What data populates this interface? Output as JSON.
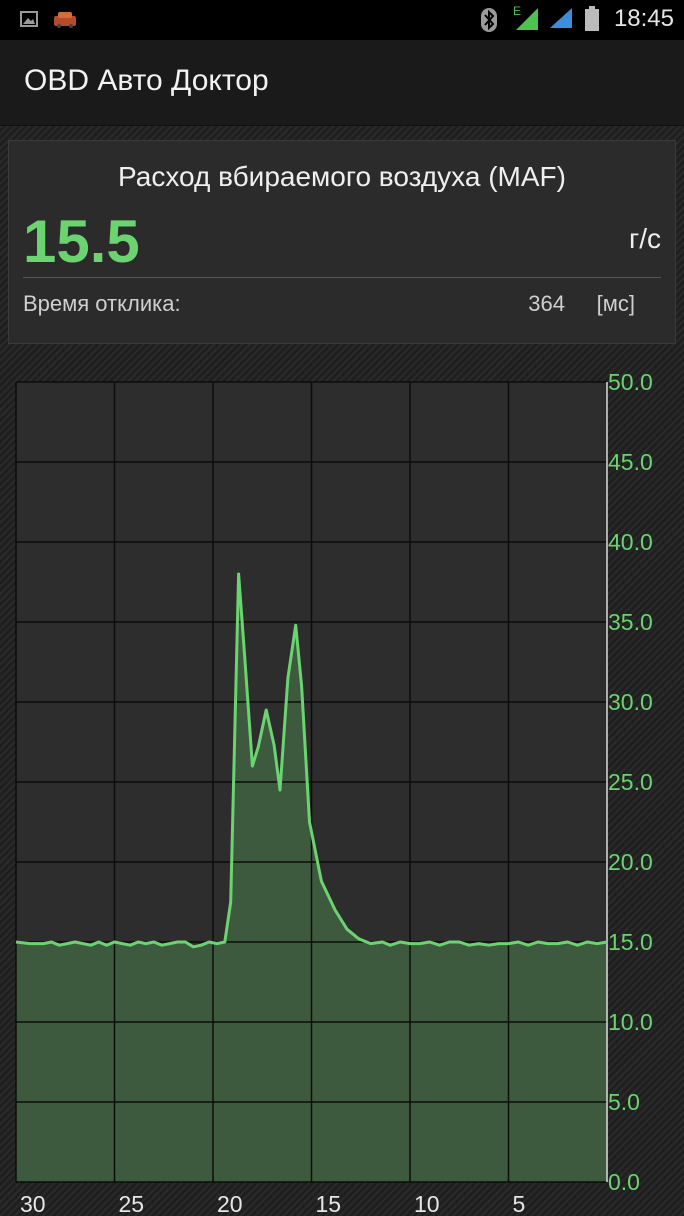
{
  "status_bar": {
    "time": "18:45",
    "icons": [
      "image-notification-icon",
      "car-notification-icon",
      "bluetooth-icon",
      "signal-e-icon",
      "signal-icon",
      "battery-icon"
    ],
    "network_label": "E"
  },
  "app": {
    "title": "OBD Авто Доктор"
  },
  "sensor": {
    "name": "Расход вбираемого воздуха (MAF)",
    "value": "15.5",
    "unit": "г/с",
    "response_label": "Время отклика:",
    "response_value": "364",
    "response_unit": "[мс]"
  },
  "colors": {
    "accent": "#6bd36f",
    "fill": "#3e5a3e",
    "grid": "#0c0c0c",
    "plot_bg": "#2d2d2d"
  },
  "chart_data": {
    "type": "area",
    "title": "",
    "xlabel": "",
    "ylabel": "",
    "ylim": [
      0,
      50
    ],
    "xlim": [
      30,
      0
    ],
    "x_ticks": [
      "30",
      "25",
      "20",
      "15",
      "10",
      "5"
    ],
    "y_ticks": [
      "50.0",
      "45.0",
      "40.0",
      "35.0",
      "30.0",
      "25.0",
      "20.0",
      "15.0",
      "10.0",
      "5.0",
      "0.0"
    ],
    "grid": true,
    "series": [
      {
        "x": [
          30,
          29.3,
          28.6,
          28.2,
          27.8,
          27.4,
          27,
          26.6,
          26.2,
          25.8,
          25.4,
          25,
          24.6,
          24.2,
          23.8,
          23.4,
          23,
          22.6,
          22.2,
          21.8,
          21.4,
          21,
          20.6,
          20.2,
          19.8,
          19.4,
          19.1,
          18.7,
          18.4,
          18,
          17.7,
          17.3,
          16.9,
          16.6,
          16.2,
          15.8,
          15.5,
          15.1,
          14.5,
          13.8,
          13.2,
          12.6,
          12,
          11.4,
          11,
          10.5,
          10,
          9.5,
          9,
          8.5,
          8,
          7.5,
          7,
          6.5,
          6,
          5.5,
          5,
          4.5,
          4,
          3.5,
          3,
          2.5,
          2,
          1.5,
          1,
          0.5,
          0
        ],
        "values": [
          15,
          14.9,
          14.9,
          15,
          14.8,
          14.9,
          15,
          14.9,
          14.8,
          15,
          14.8,
          15,
          14.9,
          14.8,
          15,
          14.9,
          15,
          14.8,
          14.9,
          15,
          15,
          14.7,
          14.8,
          15,
          14.9,
          15,
          17.5,
          38,
          33,
          26,
          27.2,
          29.5,
          27.3,
          24.5,
          31.5,
          34.8,
          31,
          22.5,
          18.8,
          17,
          15.8,
          15.2,
          14.9,
          15,
          14.8,
          15,
          14.9,
          14.9,
          15,
          14.8,
          15,
          15,
          14.8,
          14.9,
          14.8,
          14.9,
          14.9,
          15,
          14.8,
          15,
          14.9,
          14.9,
          15,
          14.8,
          15,
          14.9,
          15
        ]
      }
    ]
  }
}
